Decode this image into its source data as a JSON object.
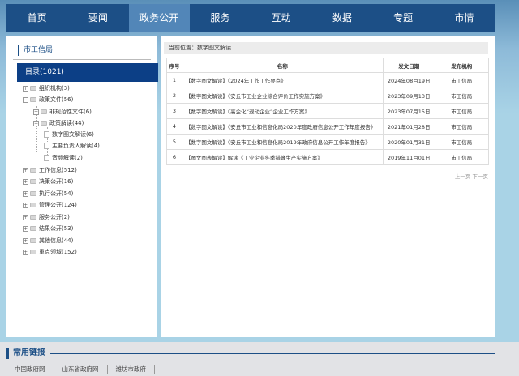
{
  "nav": {
    "items": [
      "首页",
      "要闻",
      "政务公开",
      "服务",
      "互动",
      "数据",
      "专题",
      "市情"
    ],
    "active_index": 2
  },
  "sidebar": {
    "title": "市工信局",
    "catalog": "目录(1021)",
    "tree": [
      {
        "label": "组织机构(3)",
        "level": 0,
        "icon": "plus-expander-icon"
      },
      {
        "label": "政策文件(56)",
        "level": 0,
        "icon": "minus-expander-icon"
      },
      {
        "label": "非规范性文件(6)",
        "level": 1,
        "icon": "plus-expander-icon"
      },
      {
        "label": "政策解读(44)",
        "level": 1,
        "icon": "minus-expander-icon"
      },
      {
        "label": "数字图文解读(6)",
        "level": 2,
        "icon": "document-icon"
      },
      {
        "label": "主要负责人解读(4)",
        "level": 2,
        "icon": "document-icon"
      },
      {
        "label": "音频解读(2)",
        "level": 2,
        "icon": "document-icon"
      },
      {
        "label": "工作信息(512)",
        "level": 0,
        "icon": "plus-expander-icon"
      },
      {
        "label": "决策公开(16)",
        "level": 0,
        "icon": "plus-expander-icon"
      },
      {
        "label": "执行公开(54)",
        "level": 0,
        "icon": "plus-expander-icon"
      },
      {
        "label": "管理公开(124)",
        "level": 0,
        "icon": "plus-expander-icon"
      },
      {
        "label": "服务公开(2)",
        "level": 0,
        "icon": "plus-expander-icon"
      },
      {
        "label": "结果公开(53)",
        "level": 0,
        "icon": "plus-expander-icon"
      },
      {
        "label": "其他信息(44)",
        "level": 0,
        "icon": "plus-expander-icon"
      },
      {
        "label": "重点领域(152)",
        "level": 0,
        "icon": "plus-expander-icon"
      }
    ]
  },
  "main": {
    "breadcrumb": "当前位置：数字图文解读",
    "table": {
      "headers": [
        "序号",
        "名称",
        "发文日期",
        "发布机构"
      ],
      "rows": [
        [
          "1",
          "【数字图文解读】《2024年工作工作要点》",
          "2024年08月19日",
          "市工信局"
        ],
        [
          "2",
          "【数字图文解读】《安丘市工业企业综合评价工作实施方案》",
          "2023年09月13日",
          "市工信局"
        ],
        [
          "3",
          "【数字图文解读】《高企化“退动企业”企业工作方案》",
          "2023年07月15日",
          "市工信局"
        ],
        [
          "4",
          "【数字图文解读】《安丘市工业和信息化局2020年度政府信息公开工作年度报告》",
          "2021年01月28日",
          "市工信局"
        ],
        [
          "5",
          "【数字图文解读】《安丘市工业和信息化局2019年政府信息公开工作年度报告》",
          "2020年01月31日",
          "市工信局"
        ],
        [
          "6",
          "【图文图表解读】解读《工业企业冬季错峰生产实施方案》",
          "2019年11月01日",
          "市工信局"
        ]
      ]
    },
    "pager": "上一页 下一页"
  },
  "footer": {
    "title": "常用链接",
    "links": [
      "中国政府网",
      "山东省政府网",
      "潍坊市政府"
    ]
  }
}
